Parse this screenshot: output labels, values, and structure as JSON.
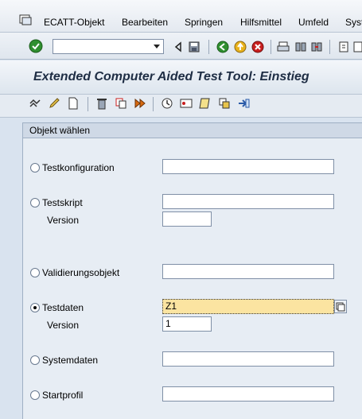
{
  "menu": {
    "items": [
      "ECATT-Objekt",
      "Bearbeiten",
      "Springen",
      "Hilfsmittel",
      "Umfeld",
      "Syst"
    ]
  },
  "system_toolbar": {
    "command_field_value": "",
    "icons": [
      "enter-icon",
      "back-icon",
      "save-icon",
      "back-nav-icon",
      "exit-icon",
      "cancel-icon",
      "print-icon",
      "find-icon",
      "find-next-icon",
      "first-page-icon"
    ]
  },
  "title": "Extended Computer Aided Test Tool: Einstieg",
  "app_toolbar": {
    "icons": [
      "test-icon",
      "edit-icon",
      "create-icon",
      "delete-icon",
      "copy-icon",
      "execute-icon",
      "clock-icon",
      "info-icon",
      "transport-icon",
      "print-icon",
      "navigate-icon"
    ]
  },
  "group": {
    "header": "Objekt wählen",
    "options": [
      {
        "label": "Testkonfiguration",
        "selected": false,
        "value": ""
      },
      {
        "label": "Testskript",
        "selected": false,
        "value": "",
        "version_label": "Version",
        "version_value": ""
      },
      {
        "label": "Validierungsobjekt",
        "selected": false,
        "value": ""
      },
      {
        "label": "Testdaten",
        "selected": true,
        "value": "Z1",
        "version_label": "Version",
        "version_value": "1"
      },
      {
        "label": "Systemdaten",
        "selected": false,
        "value": ""
      },
      {
        "label": "Startprofil",
        "selected": false,
        "value": ""
      }
    ]
  }
}
